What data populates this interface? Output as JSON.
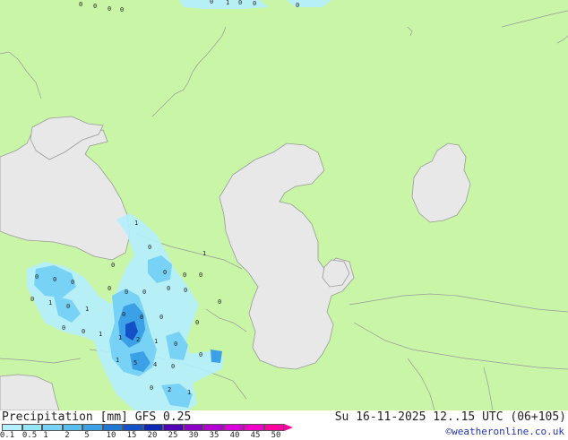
{
  "map": {
    "land_color": "#c8f5a6",
    "water_color": "#e8e8e8",
    "border_color": "#9a9a9a",
    "precip_labels": [
      {
        "t": "0"
      },
      {
        "t": "0"
      },
      {
        "t": "0"
      },
      {
        "t": "0"
      },
      {
        "t": "0"
      },
      {
        "t": "1"
      },
      {
        "t": "0"
      },
      {
        "t": "0"
      },
      {
        "t": "0"
      },
      {
        "t": "1"
      },
      {
        "t": "0"
      },
      {
        "t": "0"
      },
      {
        "t": "0"
      },
      {
        "t": "0"
      },
      {
        "t": "0"
      },
      {
        "t": "1"
      },
      {
        "t": "0"
      },
      {
        "t": "0"
      },
      {
        "t": "0"
      },
      {
        "t": "0"
      },
      {
        "t": "0"
      },
      {
        "t": "0"
      },
      {
        "t": "0"
      },
      {
        "t": "0"
      },
      {
        "t": "0"
      },
      {
        "t": "0"
      },
      {
        "t": "1"
      },
      {
        "t": "0"
      },
      {
        "t": "1"
      },
      {
        "t": "0"
      },
      {
        "t": "0"
      },
      {
        "t": "1"
      },
      {
        "t": "0"
      },
      {
        "t": "0"
      },
      {
        "t": "0"
      },
      {
        "t": "1"
      },
      {
        "t": "2"
      },
      {
        "t": "1"
      },
      {
        "t": "0"
      },
      {
        "t": "1"
      },
      {
        "t": "5"
      },
      {
        "t": "4"
      },
      {
        "t": "0"
      },
      {
        "t": "0"
      },
      {
        "t": "2"
      },
      {
        "t": "1"
      },
      {
        "t": "0"
      },
      {
        "t": "0"
      }
    ]
  },
  "legend": {
    "title": "Precipitation [mm]  GFS 0.25",
    "datetime": "Su 16-11-2025 12..15 UTC (06+105)",
    "credit": "©weatheronline.co.uk",
    "ticks": [
      "0.1",
      "0.5",
      "1",
      "2",
      "5",
      "10",
      "15",
      "20",
      "25",
      "30",
      "35",
      "40",
      "45",
      "50"
    ],
    "colors": [
      "#b4f0ff",
      "#96e6fa",
      "#78d2f5",
      "#5abef0",
      "#3ca0e6",
      "#1e78d2",
      "#1450c8",
      "#0a28b4",
      "#5000b4",
      "#8c00c8",
      "#b400d2",
      "#dc00dc",
      "#f000c8",
      "#ff00a0"
    ]
  }
}
